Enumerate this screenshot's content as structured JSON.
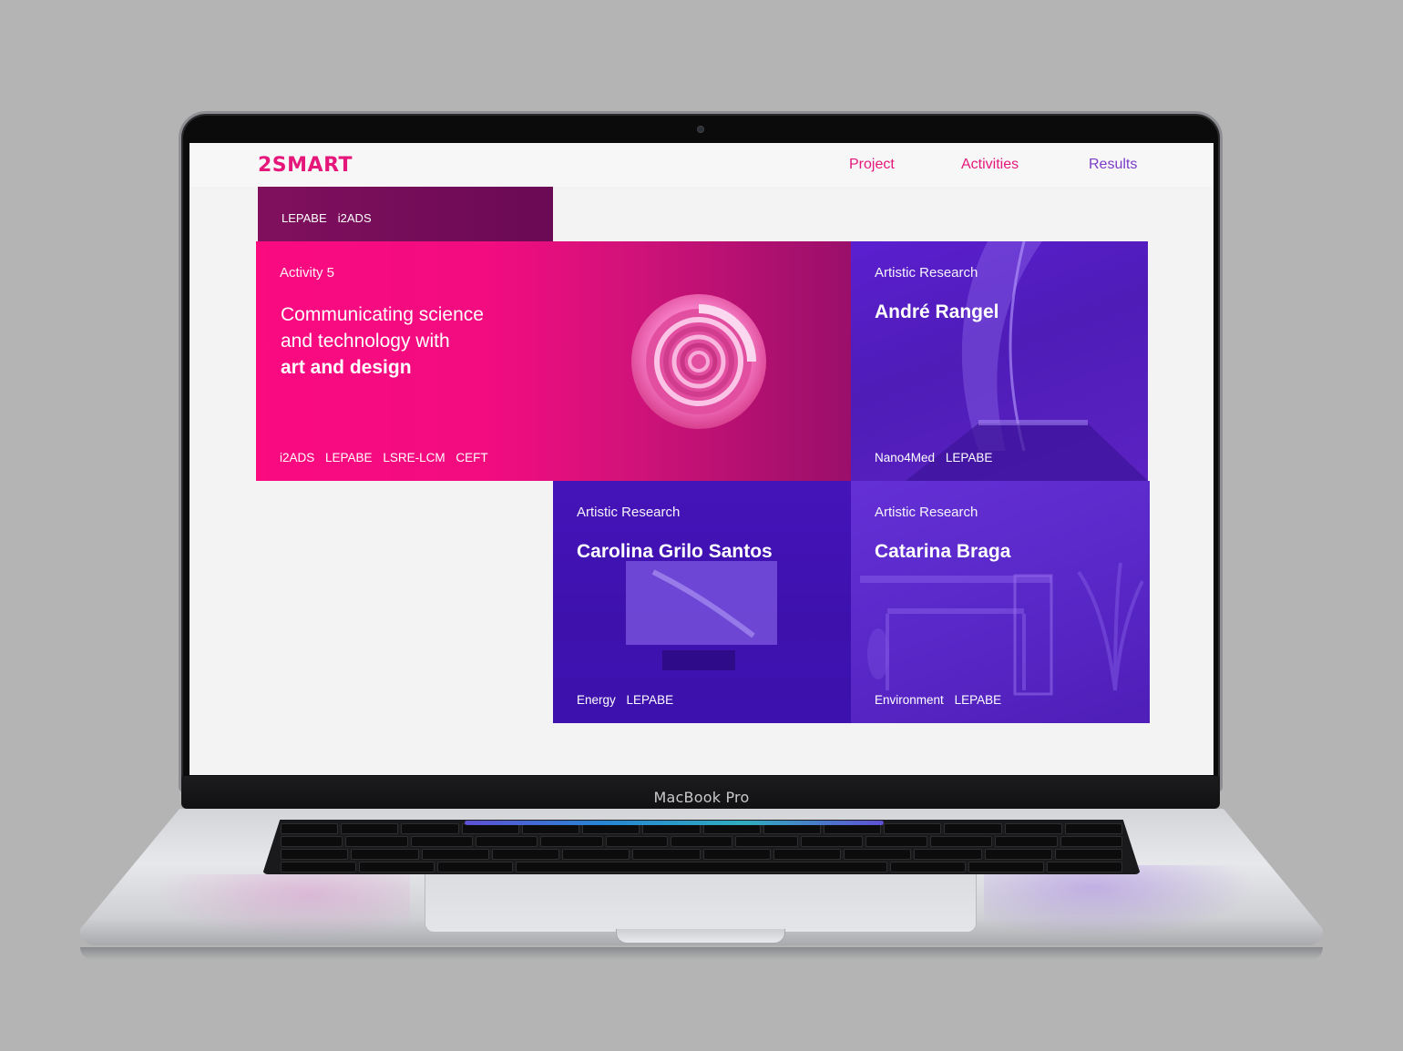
{
  "device": {
    "brand_label": "MacBook Pro"
  },
  "site": {
    "logo": "2SMART",
    "nav": [
      {
        "label": "Project"
      },
      {
        "label": "Activities"
      },
      {
        "label": "Results"
      }
    ],
    "top_tags": [
      "LEPABE",
      "i2ADS"
    ],
    "featured": {
      "label": "Activity 5",
      "headline_line1": "Communicating science",
      "headline_line2": "and technology with",
      "headline_bold": "art and design",
      "tags": [
        "i2ADS",
        "LEPABE",
        "LSRE-LCM",
        "CEFT"
      ]
    },
    "cards": [
      {
        "label": "Artistic Research",
        "name": "André Rangel",
        "tags": [
          "Nano4Med",
          "LEPABE"
        ]
      },
      {
        "label": "Artistic Research",
        "name": "Carolina Grilo Santos",
        "tags": [
          "Energy",
          "LEPABE"
        ]
      },
      {
        "label": "Artistic Research",
        "name": "Catarina Braga",
        "tags": [
          "Environment",
          "LEPABE"
        ]
      }
    ]
  },
  "colors": {
    "brand_pink": "#e5177a",
    "brand_purple": "#7b3bc7",
    "background": "#b4b4b4"
  }
}
